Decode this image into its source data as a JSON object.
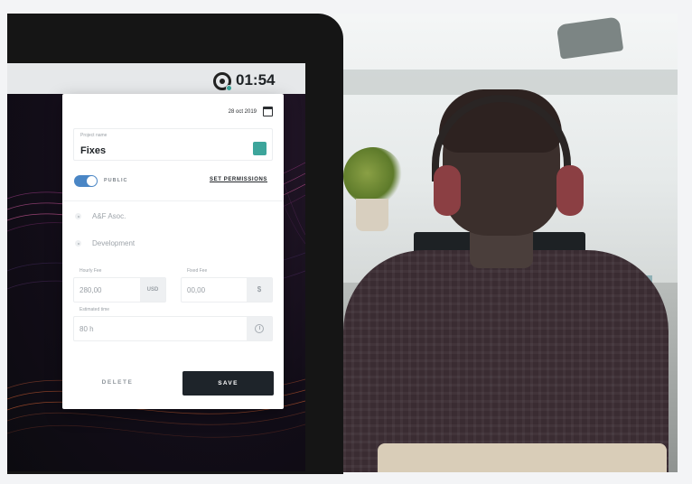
{
  "timer": {
    "value": "01:54"
  },
  "card": {
    "date": "28 oct 2019",
    "project": {
      "label": "Project name",
      "value": "Fixes",
      "color": "#3da59b"
    },
    "visibility": {
      "label": "PUBLIC",
      "on": true
    },
    "permissions_link": "SET PERMISSIONS",
    "options": [
      "A&F Asoc.",
      "Development"
    ],
    "hourly_fee": {
      "label": "Hourly Fee",
      "value": "280,00",
      "unit": "USD"
    },
    "fixed_fee": {
      "label": "Fixed Fee",
      "value": "00,00",
      "unit": "$"
    },
    "estimated_time": {
      "label": "Estimated time",
      "value": "80 h"
    },
    "delete_label": "DELETE",
    "save_label": "SAVE"
  },
  "colors": {
    "accent": "#3da59b",
    "toggle": "#4a86c5",
    "save_button": "#1e242a"
  }
}
